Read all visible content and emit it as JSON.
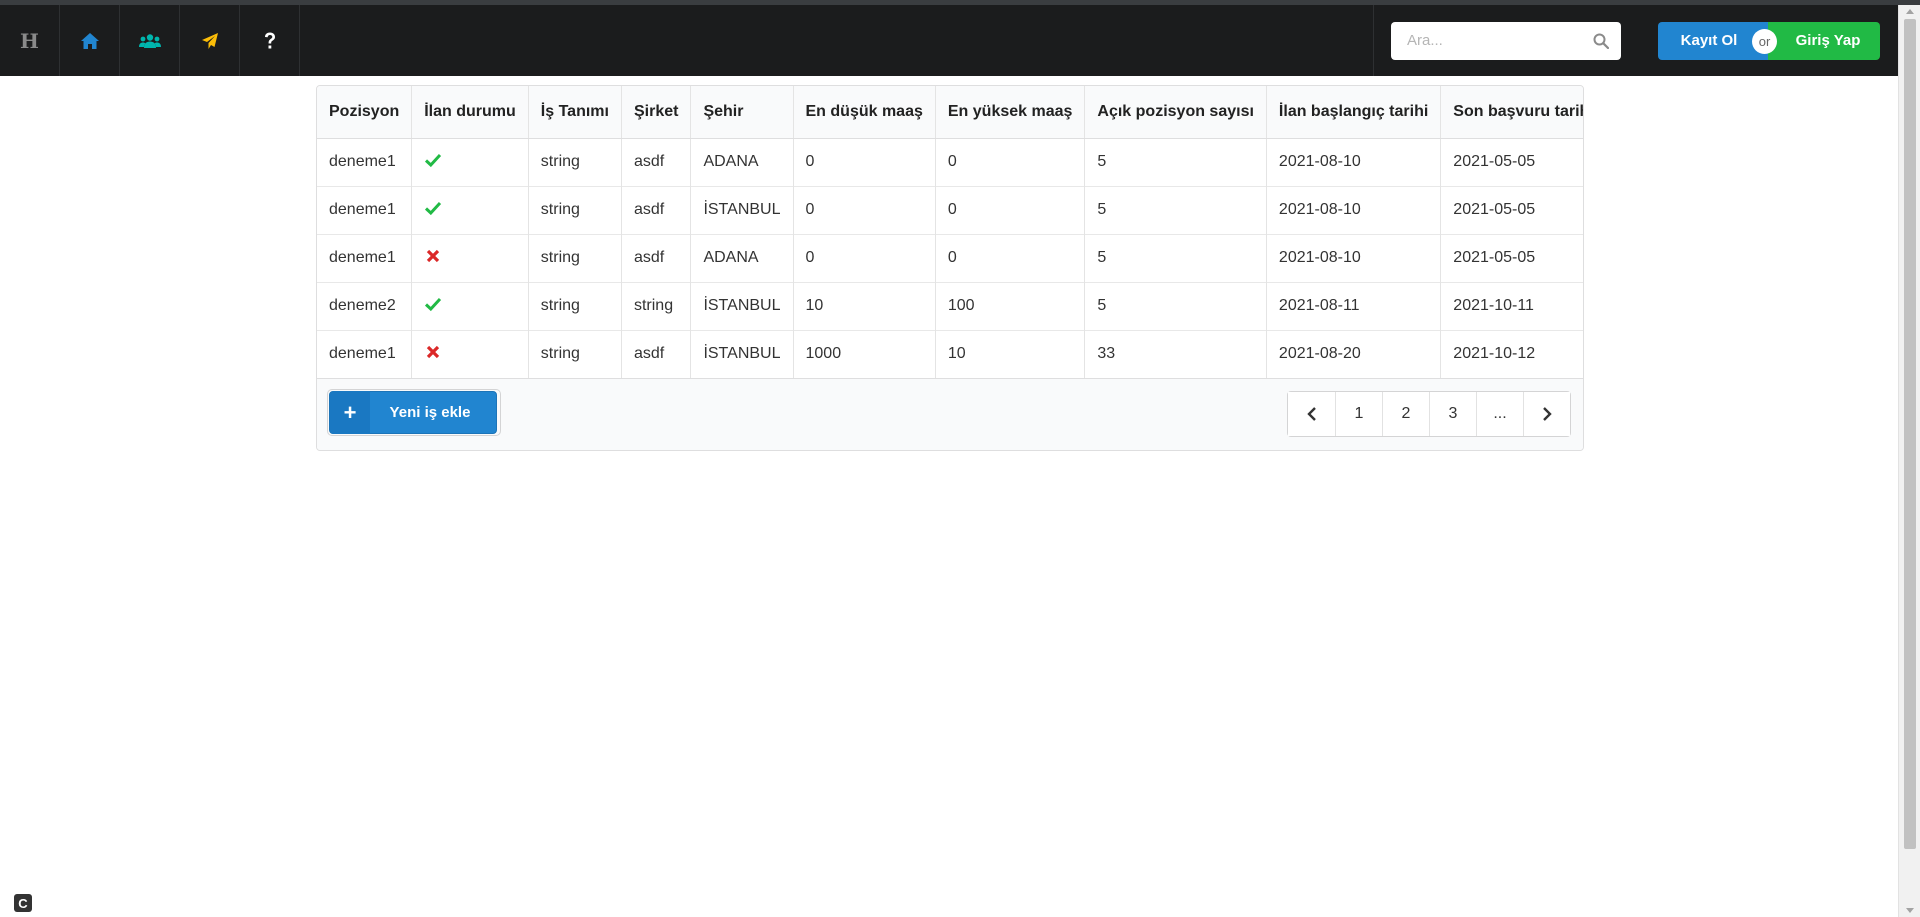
{
  "navbar": {
    "brand": "H",
    "items": [
      {
        "name": "home",
        "icon": "home-icon",
        "color": "#2185d0"
      },
      {
        "name": "users",
        "icon": "users-icon",
        "color": "#00b5ad"
      },
      {
        "name": "send",
        "icon": "paper-plane-icon",
        "color": "#fbbd08"
      },
      {
        "name": "help",
        "icon": "question-icon",
        "color": "#ffffff"
      }
    ],
    "search": {
      "placeholder": "Ara...",
      "value": ""
    },
    "register_label": "Kayıt Ol",
    "or_label": "or",
    "login_label": "Giriş Yap"
  },
  "table": {
    "headers": [
      "Pozisyon",
      "İlan durumu",
      "İş Tanımı",
      "Şirket",
      "Şehir",
      "En düşük maaş",
      "En yüksek maaş",
      "Açık pozisyon sayısı",
      "İlan başlangıç tarihi",
      "Son başvuru tarihi"
    ],
    "rows": [
      {
        "pozisyon": "deneme1",
        "active": true,
        "tanim": "string",
        "sirket": "asdf",
        "sehir": "ADANA",
        "min": "0",
        "max": "0",
        "acik": "5",
        "baslangic": "2021-08-10",
        "son": "2021-05-05"
      },
      {
        "pozisyon": "deneme1",
        "active": true,
        "tanim": "string",
        "sirket": "asdf",
        "sehir": "İSTANBUL",
        "min": "0",
        "max": "0",
        "acik": "5",
        "baslangic": "2021-08-10",
        "son": "2021-05-05"
      },
      {
        "pozisyon": "deneme1",
        "active": false,
        "tanim": "string",
        "sirket": "asdf",
        "sehir": "ADANA",
        "min": "0",
        "max": "0",
        "acik": "5",
        "baslangic": "2021-08-10",
        "son": "2021-05-05"
      },
      {
        "pozisyon": "deneme2",
        "active": true,
        "tanim": "string",
        "sirket": "string",
        "sehir": "İSTANBUL",
        "min": "10",
        "max": "100",
        "acik": "5",
        "baslangic": "2021-08-11",
        "son": "2021-10-11"
      },
      {
        "pozisyon": "deneme1",
        "active": false,
        "tanim": "string",
        "sirket": "asdf",
        "sehir": "İSTANBUL",
        "min": "1000",
        "max": "10",
        "acik": "33",
        "baslangic": "2021-08-20",
        "son": "2021-10-12"
      }
    ],
    "add_button_label": "Yeni iş ekle",
    "pagination": [
      "1",
      "2",
      "3",
      "..."
    ]
  },
  "corner_badge": "C"
}
